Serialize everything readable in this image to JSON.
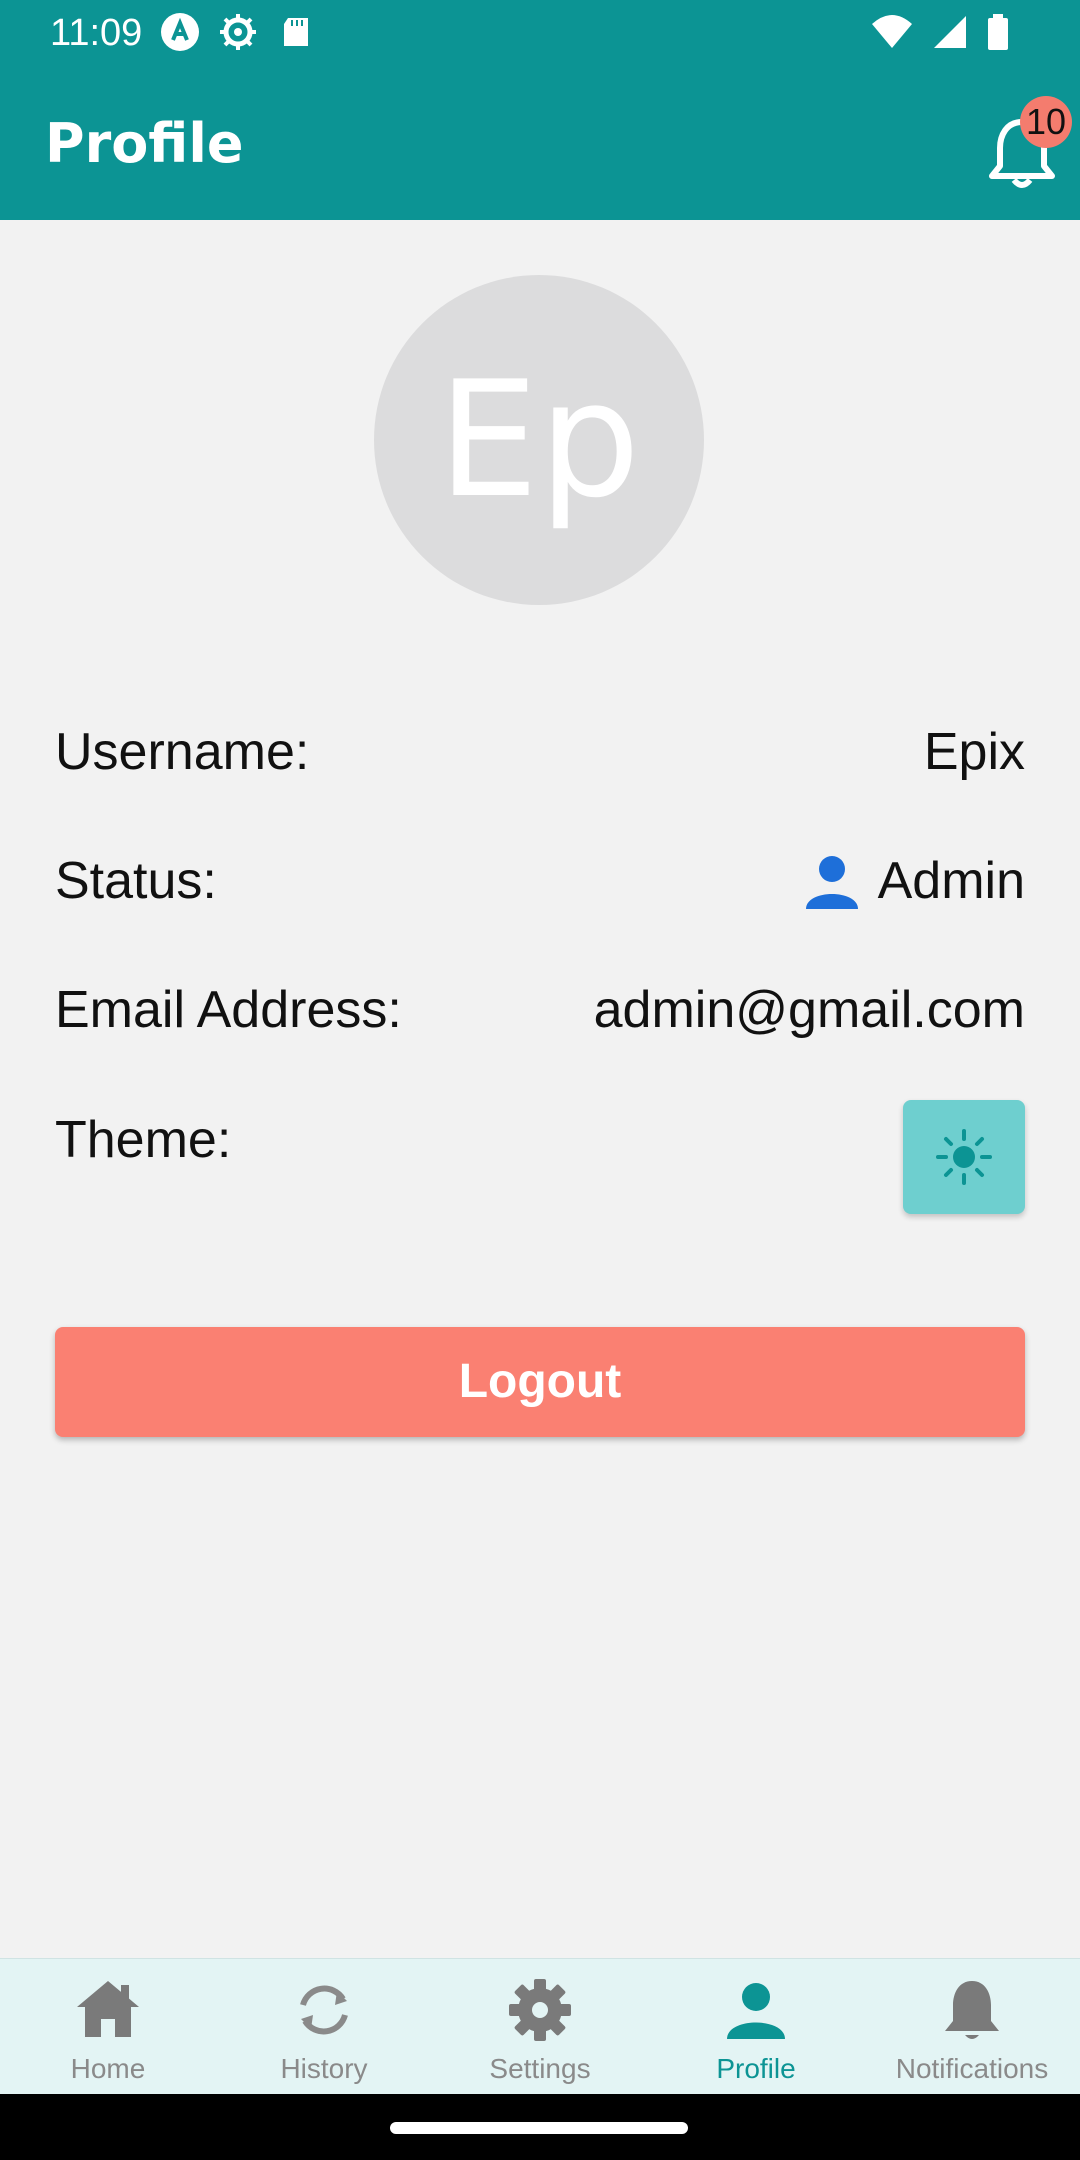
{
  "status_bar": {
    "time": "11:09"
  },
  "app_bar": {
    "title": "Profile",
    "notification_count": "10"
  },
  "avatar": {
    "initials": "Ep"
  },
  "profile": {
    "username_label": "Username:",
    "username_value": "Epix",
    "status_label": "Status:",
    "status_icon": "👤",
    "status_value": "Admin",
    "email_label": "Email Address:",
    "email_value": "admin@gmail.com",
    "theme_label": "Theme:"
  },
  "actions": {
    "logout_label": "Logout"
  },
  "bottom_nav": {
    "items": [
      {
        "label": "Home",
        "icon": "home-icon"
      },
      {
        "label": "History",
        "icon": "history-icon"
      },
      {
        "label": "Settings",
        "icon": "settings-icon"
      },
      {
        "label": "Profile",
        "icon": "profile-icon",
        "active": true
      },
      {
        "label": "Notifications",
        "icon": "notifications-icon"
      }
    ]
  },
  "colors": {
    "primary": "#0c9494",
    "logout": "#fa8072",
    "theme_button": "#6ecfcf",
    "badge": "#f47c6e",
    "nav_background": "#e3f4f4"
  }
}
